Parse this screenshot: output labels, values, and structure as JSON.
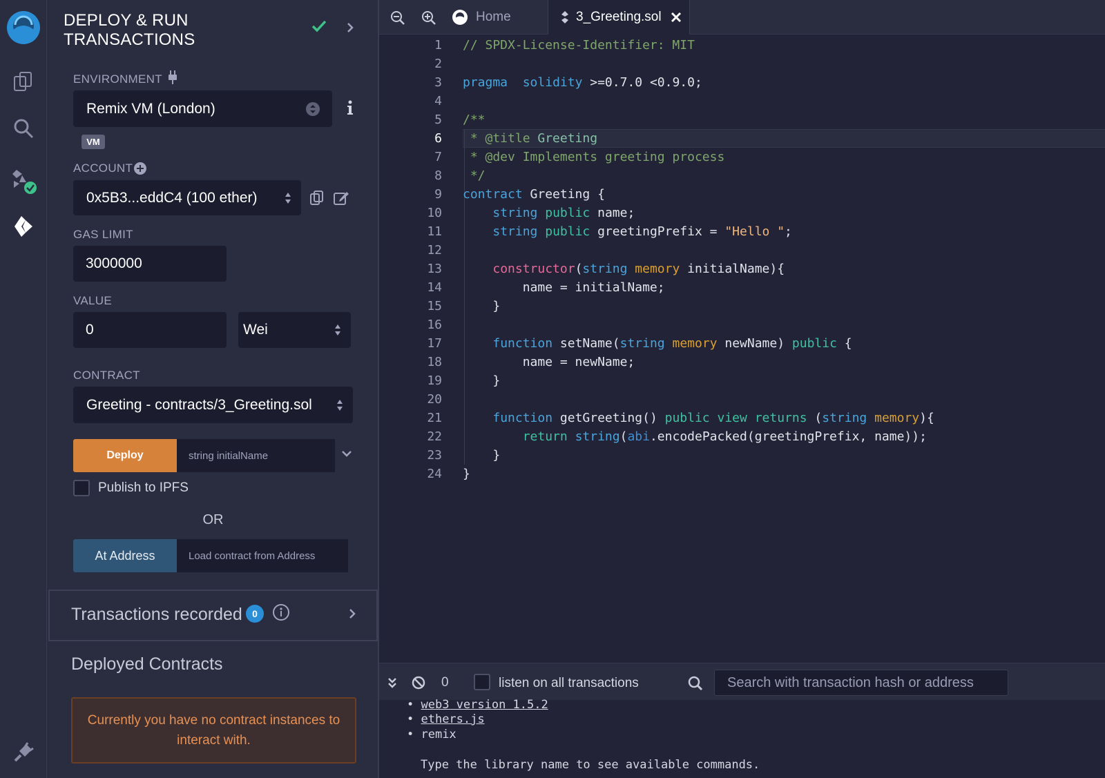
{
  "panel": {
    "title_line1": "DEPLOY & RUN",
    "title_line2": "TRANSACTIONS",
    "environment_label": "ENVIRONMENT",
    "environment_value": "Remix VM (London)",
    "vm_badge": "VM",
    "account_label": "ACCOUNT",
    "account_value": "0x5B3...eddC4 (100 ether)",
    "gas_limit_label": "GAS LIMIT",
    "gas_limit_value": "3000000",
    "value_label": "VALUE",
    "value_amount": "0",
    "value_unit": "Wei",
    "contract_label": "CONTRACT",
    "contract_value": "Greeting - contracts/3_Greeting.sol",
    "deploy_label": "Deploy",
    "deploy_arg_placeholder": "string initialName",
    "publish_label": "Publish to IPFS",
    "or_label": "OR",
    "at_address_label": "At Address",
    "at_address_placeholder": "Load contract from Address",
    "transactions_recorded_label": "Transactions recorded",
    "transactions_count": "0",
    "deployed_contracts_label": "Deployed Contracts",
    "no_instances_message": "Currently you have no contract instances to interact with."
  },
  "tabs": {
    "home_label": "Home",
    "file_label": "3_Greeting.sol"
  },
  "editor": {
    "line_numbers": [
      "1",
      "2",
      "3",
      "4",
      "5",
      "6",
      "7",
      "8",
      "9",
      "10",
      "11",
      "12",
      "13",
      "14",
      "15",
      "16",
      "17",
      "18",
      "19",
      "20",
      "21",
      "22",
      "23",
      "24"
    ],
    "active_line": "6",
    "lines": [
      [
        [
          "c-com",
          "// SPDX-License-Identifier: MIT"
        ]
      ],
      [],
      [
        [
          "c-kw",
          "pragma"
        ],
        [
          "",
          "  "
        ],
        [
          "c-kw",
          "solidity"
        ],
        [
          "",
          " >=0.7.0 <0.9.0;"
        ]
      ],
      [],
      [
        [
          "c-com",
          "/**"
        ]
      ],
      [
        [
          "c-com",
          " * @title "
        ],
        [
          "c-ins",
          "Greeting"
        ]
      ],
      [
        [
          "c-com",
          " * @dev Implements greeting process"
        ]
      ],
      [
        [
          "c-com",
          " */"
        ]
      ],
      [
        [
          "c-kw",
          "contract"
        ],
        [
          "",
          " Greeting {"
        ]
      ],
      [
        [
          "",
          "    "
        ],
        [
          "c-ty",
          "string"
        ],
        [
          "",
          " "
        ],
        [
          "c-pub",
          "public"
        ],
        [
          "",
          " name;"
        ]
      ],
      [
        [
          "",
          "    "
        ],
        [
          "c-ty",
          "string"
        ],
        [
          "",
          " "
        ],
        [
          "c-pub",
          "public"
        ],
        [
          "",
          " greetingPrefix = "
        ],
        [
          "c-str",
          "\"Hello \""
        ],
        [
          "",
          ";"
        ]
      ],
      [],
      [
        [
          "",
          "    "
        ],
        [
          "c-ctor",
          "constructor"
        ],
        [
          "",
          "("
        ],
        [
          "c-ty",
          "string"
        ],
        [
          "",
          " "
        ],
        [
          "c-mem",
          "memory"
        ],
        [
          "",
          " initialName){"
        ]
      ],
      [
        [
          "",
          "        name = initialName;"
        ]
      ],
      [
        [
          "",
          "    }"
        ]
      ],
      [],
      [
        [
          "",
          "    "
        ],
        [
          "c-kw",
          "function"
        ],
        [
          "",
          " setName("
        ],
        [
          "c-ty",
          "string"
        ],
        [
          "",
          " "
        ],
        [
          "c-mem",
          "memory"
        ],
        [
          "",
          " newName) "
        ],
        [
          "c-pub",
          "public"
        ],
        [
          "",
          " {"
        ]
      ],
      [
        [
          "",
          "        name = newName;"
        ]
      ],
      [
        [
          "",
          "    }"
        ]
      ],
      [],
      [
        [
          "",
          "    "
        ],
        [
          "c-kw",
          "function"
        ],
        [
          "",
          " getGreeting() "
        ],
        [
          "c-pub",
          "public"
        ],
        [
          "",
          " "
        ],
        [
          "c-pub",
          "view"
        ],
        [
          "",
          " "
        ],
        [
          "c-ret",
          "returns"
        ],
        [
          "",
          " ("
        ],
        [
          "c-ty",
          "string"
        ],
        [
          "",
          " "
        ],
        [
          "c-mem",
          "memory"
        ],
        [
          "",
          "){"
        ]
      ],
      [
        [
          "",
          "        "
        ],
        [
          "c-ret",
          "return"
        ],
        [
          "",
          " "
        ],
        [
          "c-ty",
          "string"
        ],
        [
          "",
          "("
        ],
        [
          "c-abi",
          "abi"
        ],
        [
          "",
          ".encodePacked(greetingPrefix, name));"
        ]
      ],
      [
        [
          "",
          "    }"
        ]
      ],
      [
        [
          "",
          "}"
        ]
      ]
    ]
  },
  "terminal": {
    "pending_count": "0",
    "listen_label": "listen on all transactions",
    "search_placeholder": "Search with transaction hash or address",
    "web3_line": "web3 version 1.5.2",
    "ethers_line": "ethers.js",
    "remix_line": "remix",
    "hint_line": "Type the library name to see available commands."
  },
  "colors": {
    "accent_deploy": "#d7823a",
    "accent_at_address": "#2f5677",
    "success_check": "#3fc28a",
    "count_badge": "#2a8fd6"
  }
}
